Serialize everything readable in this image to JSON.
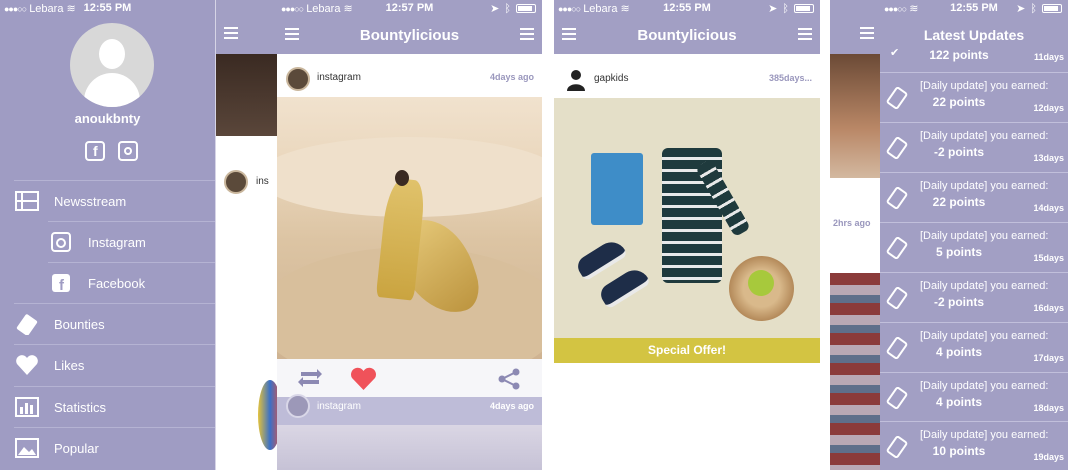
{
  "screen1": {
    "status": {
      "carrier": "Lebara",
      "time": "12:55 PM"
    },
    "username": "anoukbnty",
    "menu": [
      {
        "label": "Newsstream",
        "icon": "film-icon",
        "sub": false
      },
      {
        "label": "Instagram",
        "icon": "instagram-icon",
        "sub": true
      },
      {
        "label": "Facebook",
        "icon": "facebook-icon",
        "sub": true
      },
      {
        "label": "Bounties",
        "icon": "ticket-icon",
        "sub": false
      },
      {
        "label": "Likes",
        "icon": "heart-icon",
        "sub": false
      },
      {
        "label": "Statistics",
        "icon": "bar-chart-icon",
        "sub": false
      },
      {
        "label": "Popular",
        "icon": "image-icon",
        "sub": false
      }
    ],
    "peek_name": "ins"
  },
  "screen2": {
    "status": {
      "carrier": "Lebara",
      "time": "12:57 PM"
    },
    "title": "Bountylicious",
    "card1": {
      "name": "instagram",
      "time": "4days ago"
    },
    "card2": {
      "name": "instagram",
      "time": "4days ago"
    }
  },
  "screen3": {
    "status": {
      "carrier": "Lebara",
      "time": "12:55 PM"
    },
    "title": "Bountylicious",
    "card": {
      "name": "gapkids",
      "time": "385days..."
    },
    "offer": "Special Offer!"
  },
  "screen4": {
    "status": {
      "carrier": "Lebara",
      "time": "12:55 PM"
    },
    "title": "Latest Updates",
    "left_time": "2hrs ago",
    "first": {
      "points": "122 points",
      "days": "11days"
    },
    "updates": [
      {
        "text": "[Daily update] you earned:",
        "points": "22 points",
        "days": "12days"
      },
      {
        "text": "[Daily update] you earned:",
        "points": "-2 points",
        "days": "13days"
      },
      {
        "text": "[Daily update] you earned:",
        "points": "22 points",
        "days": "14days"
      },
      {
        "text": "[Daily update] you earned:",
        "points": "5 points",
        "days": "15days"
      },
      {
        "text": "[Daily update] you earned:",
        "points": "-2 points",
        "days": "16days"
      },
      {
        "text": "[Daily update] you earned:",
        "points": "4 points",
        "days": "17days"
      },
      {
        "text": "[Daily update] you earned:",
        "points": "4 points",
        "days": "18days"
      },
      {
        "text": "[Daily update] you earned:",
        "points": "10 points",
        "days": "19days"
      }
    ]
  },
  "colors": {
    "accent": "#a29fc4",
    "heart": "#f0525a",
    "offer": "#d3c442"
  }
}
